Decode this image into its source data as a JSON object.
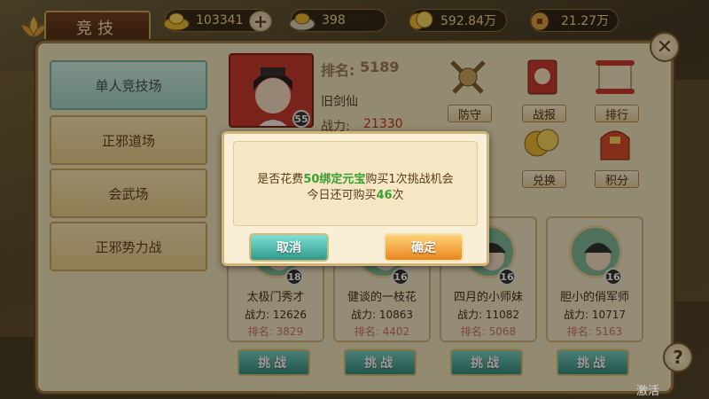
{
  "header": {
    "title": "竞技",
    "currencies": [
      {
        "icon": "gold-ingot-icon",
        "value": "103341"
      },
      {
        "icon": "silver-ingot-icon",
        "value": "398"
      },
      {
        "icon": "coin-stack-icon",
        "value": "592.84万"
      },
      {
        "icon": "copper-coin-icon",
        "value": "21.27万"
      }
    ]
  },
  "sidebar": {
    "items": [
      {
        "label": "单人竞技场",
        "active": true
      },
      {
        "label": "正邪道场"
      },
      {
        "label": "会武场"
      },
      {
        "label": "正邪势力战"
      }
    ]
  },
  "player": {
    "rank_label": "排名:",
    "rank": "5189",
    "name": "旧剑仙",
    "power_label": "战力:",
    "power": "21330",
    "level": "55"
  },
  "actions": [
    {
      "label": "防守",
      "icon": "crossed-swords-icon"
    },
    {
      "label": "战报",
      "icon": "battle-report-scroll-icon"
    },
    {
      "label": "排行",
      "icon": "ranking-scroll-icon"
    },
    {
      "label": "兑换",
      "icon": "gold-coins-icon"
    },
    {
      "label": "积分",
      "icon": "gift-bag-icon"
    }
  ],
  "opponents": [
    {
      "name": "太极门秀才",
      "power": "战力: 12626",
      "rank": "排名: 3829",
      "level": "18"
    },
    {
      "name": "健谈的一枝花",
      "power": "战力: 10863",
      "rank": "排名: 4402",
      "level": "16"
    },
    {
      "name": "四月的小师妹",
      "power": "战力: 11082",
      "rank": "排名: 5068",
      "level": "16"
    },
    {
      "name": "胆小的俏军师",
      "power": "战力: 10717",
      "rank": "排名: 5163",
      "level": "16"
    }
  ],
  "challenge_label": "挑战",
  "dialog": {
    "line1_pre": "是否花费",
    "line1_hl": "50绑定元宝",
    "line1_post": "购买1次挑战机会",
    "line2_pre": "今日还可购买",
    "line2_hl": "46",
    "line2_post": "次",
    "cancel": "取消",
    "confirm": "确定"
  },
  "watermark": "激活 Windows",
  "colors": {
    "highlight": "#3aa030",
    "power": "#c42a1a",
    "rank": "#c0706a",
    "cancel_button": "#2d9a8c",
    "confirm_button": "#e8861e"
  }
}
